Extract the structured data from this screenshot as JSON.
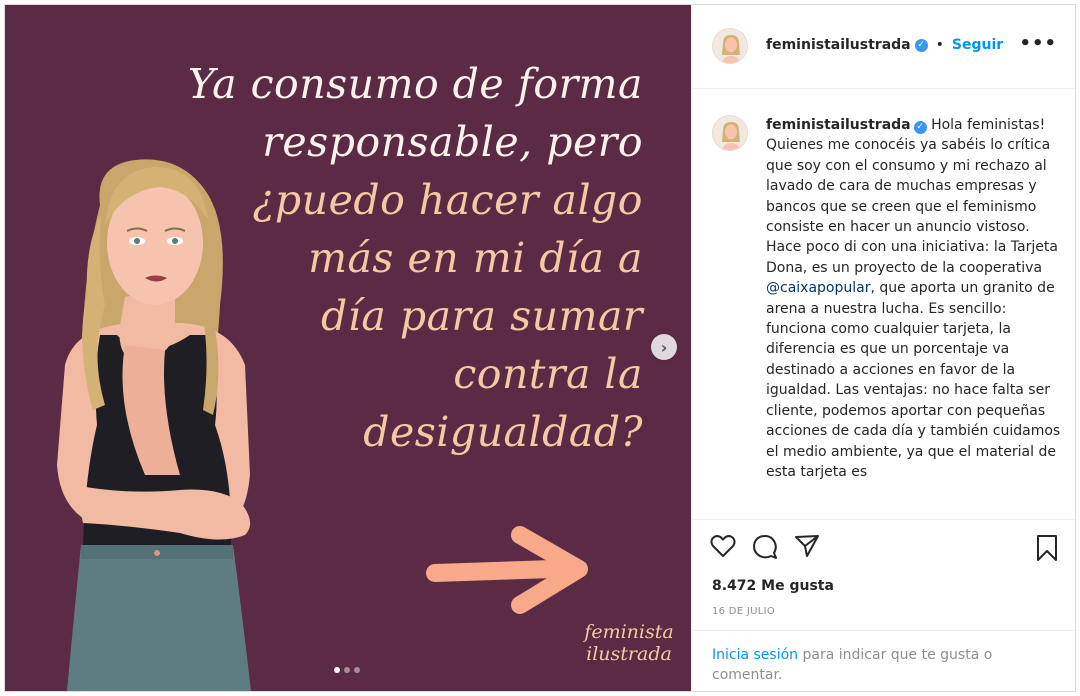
{
  "post": {
    "headline": {
      "lines": [
        {
          "text": "Ya consumo de forma",
          "tone": "white"
        },
        {
          "text": "responsable, pero",
          "tone": "white"
        },
        {
          "text": "¿puedo hacer algo",
          "tone": "peach"
        },
        {
          "text": "más en mi día a",
          "tone": "peach"
        },
        {
          "text": "día para sumar",
          "tone": "peach"
        },
        {
          "text": "contra la",
          "tone": "peach"
        },
        {
          "text": "desigualdad?",
          "tone": "peach"
        }
      ]
    },
    "brand_lines": [
      "feminista",
      "ilustrada"
    ],
    "next_icon": "chevron-right-icon",
    "carousel_dots": 3,
    "active_dot": 0,
    "colors": {
      "background": "#5b2b45",
      "accent": "#f6c9a4",
      "arrow": "#f7a98a"
    }
  },
  "header": {
    "username": "feministailustrada",
    "verified_icon": "verified-badge-icon",
    "separator": "•",
    "follow_label": "Seguir",
    "more_label": "•••"
  },
  "caption": {
    "username": "feministailustrada",
    "text_before_mention": "Hola feministas! Quienes me conocéis ya sabéis lo crítica que soy con el consumo y mi rechazo al lavado de cara de muchas empresas y bancos que se creen que el feminismo consiste en hacer un anuncio vistoso. Hace poco di con una iniciativa: la Tarjeta Dona, es un proyecto de la cooperativa ",
    "mention": "@caixapopular",
    "text_after_mention": ", que aporta un granito de arena a nuestra lucha. Es sencillo: funciona como cualquier tarjeta, la diferencia es que un porcentaje va destinado a acciones en favor de la igualdad. Las ventajas: no hace falta ser cliente, podemos aportar con pequeñas acciones de cada día y también cuidamos el medio ambiente, ya que el material de esta tarjeta es"
  },
  "actions": {
    "icons": [
      "heart-icon",
      "comment-icon",
      "share-icon",
      "bookmark-icon"
    ],
    "likes": "8.472 Me gusta",
    "date": "16 DE JULIO"
  },
  "login": {
    "link": "Inicia sesión",
    "text": " para indicar que te gusta o comentar."
  }
}
